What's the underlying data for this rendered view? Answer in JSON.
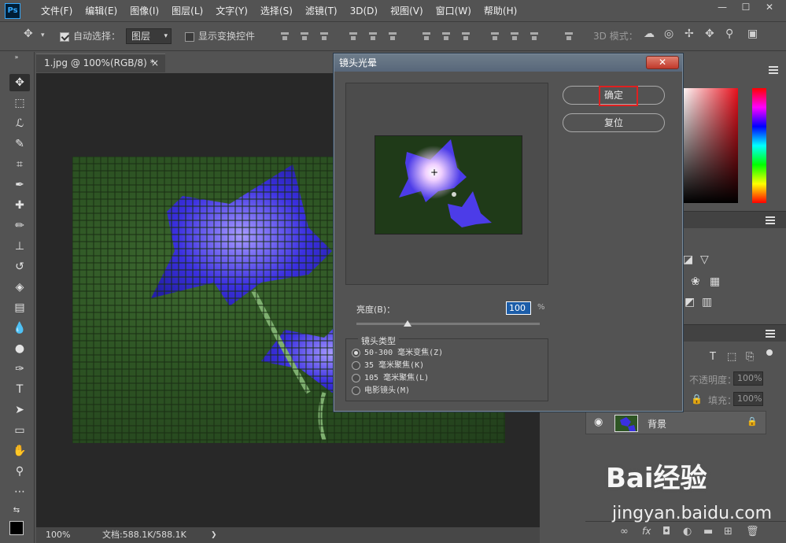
{
  "app": {
    "logo": "Ps"
  },
  "menu": [
    "文件(F)",
    "编辑(E)",
    "图像(I)",
    "图层(L)",
    "文字(Y)",
    "选择(S)",
    "滤镜(T)",
    "3D(D)",
    "视图(V)",
    "窗口(W)",
    "帮助(H)"
  ],
  "window_controls": {
    "minimize": "—",
    "restore": "☐",
    "close": "✕"
  },
  "options_bar": {
    "auto_select_label": "自动选择：",
    "auto_select_checked": true,
    "layer_select_value": "图层",
    "show_transform_label": "显示变换控件",
    "mode_3d_label": "3D 模式："
  },
  "document": {
    "tab_title": "1.jpg @ 100%(RGB/8) *",
    "tab_close": "×",
    "zoom": "100%",
    "doc_info": "文档:588.1K/588.1K",
    "status_arrow": "❯"
  },
  "dialog": {
    "title": "镜头光晕",
    "close": "✕",
    "ok_label": "确定",
    "reset_label": "复位",
    "brightness_label": "亮度(B)：",
    "brightness_value": "100",
    "brightness_unit": "%",
    "brightness_level_percent": 28,
    "lens_type_label": "镜头类型",
    "lens_options": [
      {
        "label": "50-300 毫米变焦(Z)",
        "selected": true
      },
      {
        "label": "35 毫米聚焦(K)",
        "selected": false
      },
      {
        "label": "105 毫米聚焦(L)",
        "selected": false
      },
      {
        "label": "电影镜头(M)",
        "selected": false
      }
    ]
  },
  "layers": {
    "opacity_label": "不透明度：",
    "opacity_value": "100%",
    "fill_label": "填充：",
    "fill_value": "100%",
    "background_layer_name": "背景"
  },
  "layers_bottom_icons": [
    "link-icon",
    "fx-icon",
    "mask-icon",
    "adjustment-icon",
    "folder-icon",
    "new-layer-icon",
    "trash-icon"
  ],
  "watermark": {
    "brand": "Bai经验",
    "url": "jingyan.baidu.com"
  },
  "colors": {
    "accent": "#31a8ff",
    "highlight_red": "#e02020",
    "input_blue": "#1c5da8"
  }
}
